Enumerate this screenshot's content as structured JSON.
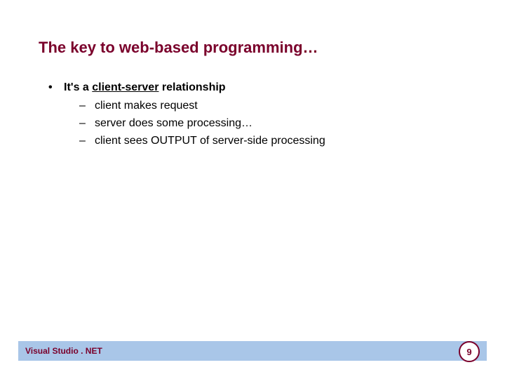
{
  "title": "The key to web-based programming…",
  "bullet": {
    "prefix": "It's a ",
    "underlined": "client-server",
    "suffix": " relationship"
  },
  "subitems": [
    "client makes request",
    "server does some processing…",
    "client sees OUTPUT of server-side processing"
  ],
  "footer": {
    "text": "Visual Studio . NET",
    "page": "9"
  }
}
